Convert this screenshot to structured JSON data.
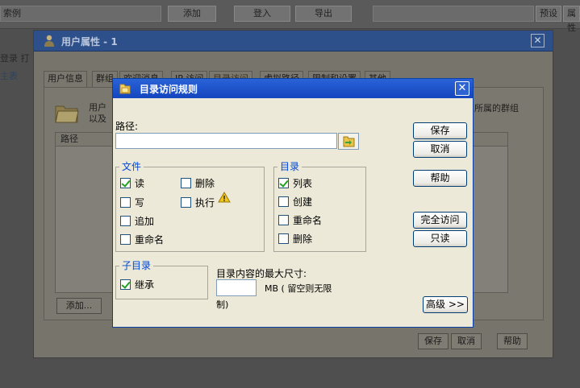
{
  "background": {
    "toolbar": {
      "field1": "索例",
      "add": "添加",
      "login": "登入",
      "export": "导出",
      "edit": "预设",
      "extra": "属性"
    },
    "sidebar_text1": "登录 打",
    "sidebar_text2": "主表"
  },
  "user_window": {
    "title": "用户属性 - 1",
    "tabs": [
      "用户信息",
      "群组",
      "欢迎消息",
      "IP 访问",
      "目录访问",
      "虚拟路径",
      "限制和设置",
      "其他"
    ],
    "info_line1": "用户",
    "info_line2": "以及",
    "info_right": "所属的群组",
    "list_header": "路径",
    "add_button": "添加...",
    "save_button": "保存",
    "cancel_button": "取消",
    "help_button": "帮助"
  },
  "dialog": {
    "title": "目录访问规则",
    "path_label": "路径:",
    "path_value": "",
    "files_group": "文件",
    "files": [
      {
        "label": "读",
        "checked": true
      },
      {
        "label": "写",
        "checked": false
      },
      {
        "label": "追加",
        "checked": false
      },
      {
        "label": "重命名",
        "checked": false
      },
      {
        "label": "删除",
        "checked": false
      },
      {
        "label": "执行",
        "checked": false
      }
    ],
    "dirs_group": "目录",
    "dirs": [
      {
        "label": "列表",
        "checked": true
      },
      {
        "label": "创建",
        "checked": false
      },
      {
        "label": "重命名",
        "checked": false
      },
      {
        "label": "删除",
        "checked": false
      }
    ],
    "subdir_group": "子目录",
    "inherit_label": "继承",
    "inherit_checked": true,
    "max_size_label": "目录内容的最大尺寸:",
    "max_size_value": "",
    "mb_text": "MB ( 留空则无限",
    "mb_text2": "制)",
    "buttons": {
      "save": "保存",
      "cancel": "取消",
      "help": "帮助",
      "full_access": "完全访问",
      "read_only": "只读",
      "advanced": "高级 >>"
    }
  }
}
